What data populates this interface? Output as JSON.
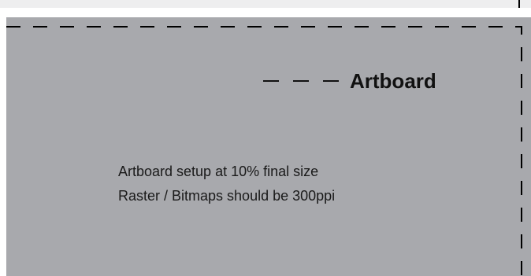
{
  "artboard": {
    "title": "Artboard",
    "notes": [
      "Artboard setup at 10% final size",
      "Raster / Bitmaps should be 300ppi"
    ]
  },
  "colors": {
    "artboard_fill": "#a8a9ad",
    "border": "#000000"
  }
}
